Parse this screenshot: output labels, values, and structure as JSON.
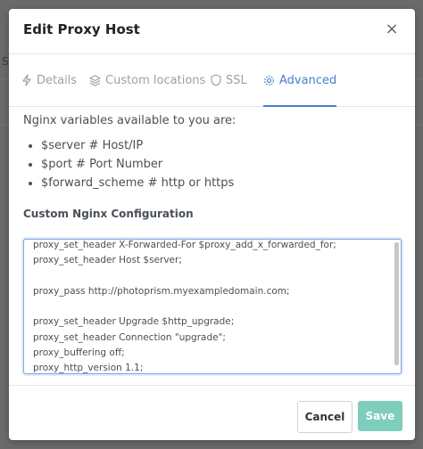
{
  "modal": {
    "title": "Edit Proxy Host",
    "close_label": "×",
    "tabs": [
      {
        "label": "Details",
        "icon": "bolt-icon"
      },
      {
        "label": "Custom locations",
        "icon": "layers-icon"
      },
      {
        "label": "SSL",
        "icon": "shield-icon"
      },
      {
        "label": "Advanced",
        "icon": "gear-icon"
      }
    ],
    "active_tab": "Advanced",
    "intro": "Nginx variables available to you are:",
    "variables": [
      "$server # Host/IP",
      "$port # Port Number",
      "$forward_scheme # http or https"
    ],
    "config_label": "Custom Nginx Configuration",
    "config_lines": [
      "proxy_set_header X-Forwarded-For $proxy_add_x_forwarded_for;",
      "proxy_set_header Host $server;",
      "",
      "proxy_pass http://photoprism.myexampledomain.com;",
      "",
      "proxy_set_header Upgrade $http_upgrade;",
      "proxy_set_header Connection \"upgrade\";",
      "proxy_buffering off;",
      "proxy_http_version 1.1;"
    ],
    "cancel_label": "Cancel",
    "save_label": "Save",
    "accent_color": "#467fcf",
    "save_color": "#7fcdbd"
  },
  "background": {
    "partial_text": "Sl"
  }
}
